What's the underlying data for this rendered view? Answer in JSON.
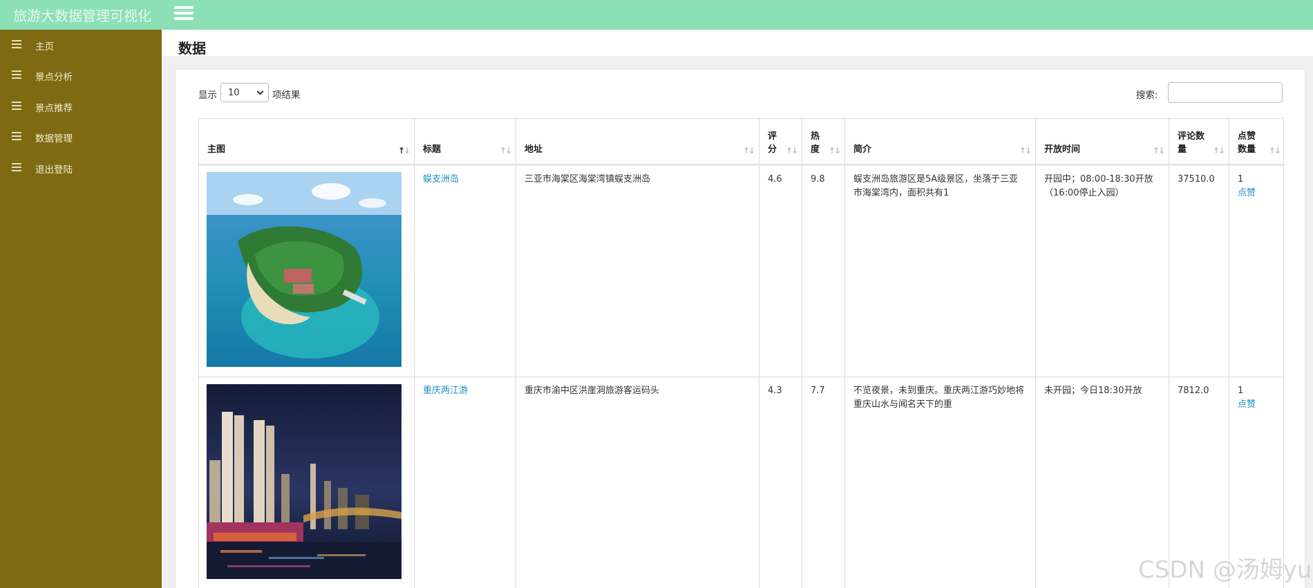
{
  "app": {
    "title": "旅游大数据管理可视化"
  },
  "sidebar": {
    "items": [
      {
        "label": "主页"
      },
      {
        "label": "景点分析"
      },
      {
        "label": "景点推荐"
      },
      {
        "label": "数据管理"
      },
      {
        "label": "退出登陆"
      }
    ]
  },
  "page": {
    "title": "数据"
  },
  "table_controls": {
    "length_prefix": "显示",
    "length_value": "10",
    "length_suffix": "项结果",
    "search_label": "搜索:",
    "search_value": ""
  },
  "table": {
    "columns": [
      {
        "label": "主图",
        "sort": "↑↓"
      },
      {
        "label": "标题",
        "sort": "↑↓"
      },
      {
        "label": "地址",
        "sort": "↑↓"
      },
      {
        "label": "评分",
        "sort": "↑↓"
      },
      {
        "label": "热度",
        "sort": "↑↓"
      },
      {
        "label": "简介",
        "sort": "↑↓"
      },
      {
        "label": "开放时间",
        "sort": "↑↓"
      },
      {
        "label": "评论数量",
        "sort": "↑↓"
      },
      {
        "label": "点赞数量",
        "sort": "↑↓"
      }
    ],
    "rows": [
      {
        "title": "蜈支洲岛",
        "address": "三亚市海棠区海棠湾镇蜈支洲岛",
        "score": "4.6",
        "heat": "9.8",
        "intro": "蜈支洲岛旅游区是5A级景区，坐落于三亚市海棠湾内，面积共有1",
        "open_time": "开园中；08:00-18:30开放（16:00停止入园）",
        "comments": "37510.0",
        "likes": "1",
        "like_action": "点赞"
      },
      {
        "title": "重庆两江游",
        "address": "重庆市渝中区洪崖洞旅游客运码头",
        "score": "4.3",
        "heat": "7.7",
        "intro": "不览夜景，未到重庆。重庆两江游巧妙地将重庆山水与闻名天下的重",
        "open_time": "未开园；今日18:30开放",
        "comments": "7812.0",
        "likes": "1",
        "like_action": "点赞"
      }
    ]
  },
  "watermark": "CSDN @汤姆yu",
  "colors": {
    "topbar": "#8ce0b6",
    "sidebar": "#7d6a12",
    "link": "#1d8fc4"
  }
}
